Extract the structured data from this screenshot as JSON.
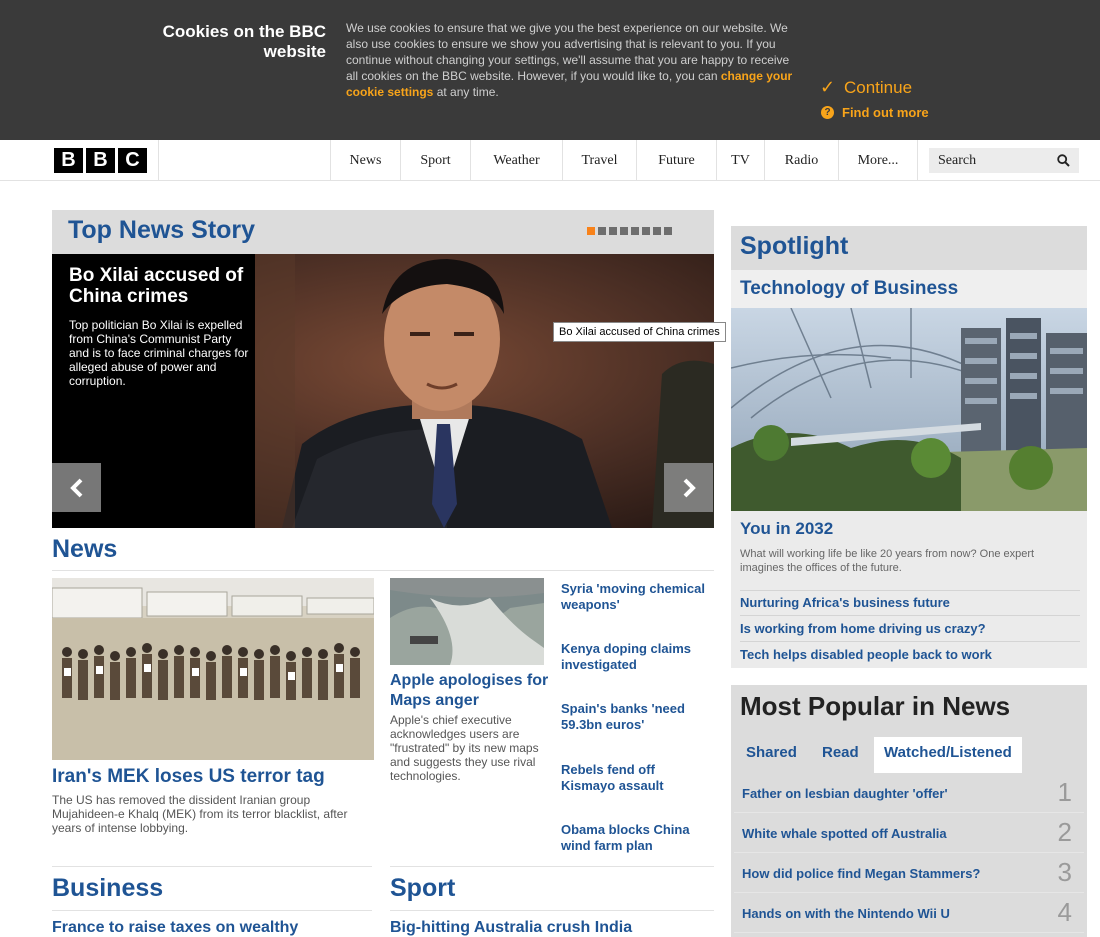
{
  "cookie_banner": {
    "title": "Cookies on the BBC website",
    "text_before_link": "We use cookies to ensure that we give you the best experience on our website. We also use cookies to ensure we show you advertising that is relevant to you. If you continue without changing your settings, we'll assume that you are happy to receive all cookies on the BBC website. However, if you would like to, you can ",
    "link_text": "change your cookie settings",
    "text_after_link": " at any time.",
    "continue_label": "Continue",
    "find_out_more_label": "Find out more",
    "accent_color": "#f8a41a"
  },
  "header": {
    "logo_letters": [
      "B",
      "B",
      "C"
    ],
    "nav": [
      "News",
      "Sport",
      "Weather",
      "Travel",
      "Future",
      "TV",
      "Radio",
      "More..."
    ],
    "search_label": "Search"
  },
  "top_story": {
    "section_title": "Top News Story",
    "headline": "Bo Xilai accused of China crimes",
    "summary": "Top politician Bo Xilai is expelled from China's Communist Party and is to face criminal charges for alleged abuse of power and corruption.",
    "tooltip": "Bo Xilai accused of China crimes",
    "carousel_slides": 8,
    "active_slide": 1
  },
  "news": {
    "section_title": "News",
    "main": {
      "headline": "Iran's MEK loses US terror tag",
      "summary": "The US has removed the dissident Iranian group Mujahideen-e Khalq (MEK) from its terror blacklist, after years of intense lobbying."
    },
    "secondary": {
      "headline": "Apple apologises for Maps anger",
      "summary": "Apple's chief executive acknowledges users are \"frustrated\" by its new maps and suggests they use rival technologies."
    },
    "links": [
      "Syria 'moving chemical weapons'",
      "Kenya doping claims investigated",
      "Spain's banks 'need 59.3bn euros'",
      "Rebels fend off Kismayo assault",
      "Obama blocks China wind farm plan"
    ]
  },
  "business": {
    "section_title": "Business",
    "headline": "France to raise taxes on wealthy"
  },
  "sport": {
    "section_title": "Sport",
    "headline": "Big-hitting Australia crush India"
  },
  "spotlight": {
    "section_title": "Spotlight",
    "subtitle": "Technology of Business",
    "headline": "You in 2032",
    "summary": "What will working life be like 20 years from now? One expert imagines the offices of the future.",
    "links": [
      "Nurturing Africa's business future",
      "Is working from home driving us crazy?",
      "Tech helps disabled people back to work"
    ]
  },
  "most_popular": {
    "title": "Most Popular in News",
    "tabs": [
      "Shared",
      "Read",
      "Watched/Listened"
    ],
    "active_tab": "Watched/Listened",
    "items": [
      {
        "rank": "1",
        "title": "Father on lesbian daughter 'offer'"
      },
      {
        "rank": "2",
        "title": "White whale spotted off Australia"
      },
      {
        "rank": "3",
        "title": "How did police find Megan Stammers?"
      },
      {
        "rank": "4",
        "title": "Hands on with the Nintendo Wii U"
      }
    ]
  },
  "colors": {
    "link_blue": "#1f5494",
    "banner_bg": "#3a3a3a",
    "panel_grey": "#dcdcdc",
    "carousel_active": "#f8821a"
  }
}
